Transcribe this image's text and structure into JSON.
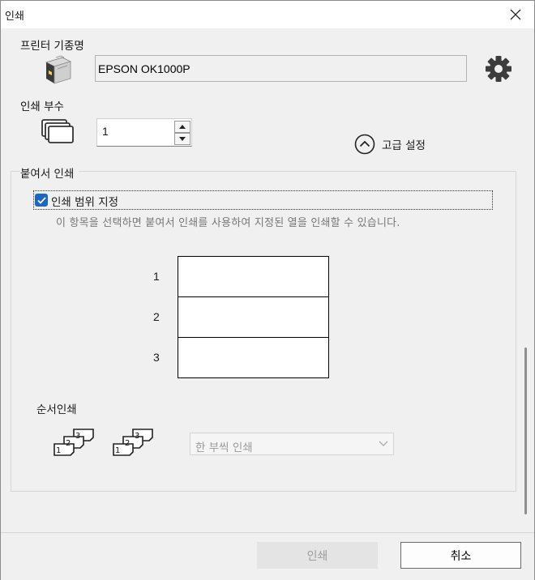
{
  "window": {
    "title": "인쇄"
  },
  "printer": {
    "label": "프린터 기종명",
    "value": "EPSON OK1000P",
    "printer_icon": "label-printer-icon",
    "settings_icon": "gear-icon"
  },
  "copies": {
    "label": "인쇄 부수",
    "value": "1",
    "icon": "stacked-pages-icon"
  },
  "advanced": {
    "label": "고급 설정",
    "icon": "chevron-up-circle-icon"
  },
  "paste_print": {
    "group_title": "붙여서 인쇄",
    "range_checkbox_label": "인쇄 범위 지정",
    "range_checked": true,
    "hint": "이 항목을 선택하면 붙여서 인쇄를 사용하여 지정된 열을 인쇄할 수 있습니다.",
    "rows": [
      "1",
      "2",
      "3"
    ]
  },
  "order_print": {
    "title": "순서인쇄",
    "icons": [
      "collate-order-icon",
      "collate-order-icon"
    ],
    "select_value": "한 부씩 인쇄"
  },
  "buttons": {
    "print": "인쇄",
    "cancel": "취소"
  },
  "colors": {
    "accent": "#1a67c4",
    "dialog_bg": "#f0f0f0",
    "disabled_text": "#9c9c9c"
  }
}
